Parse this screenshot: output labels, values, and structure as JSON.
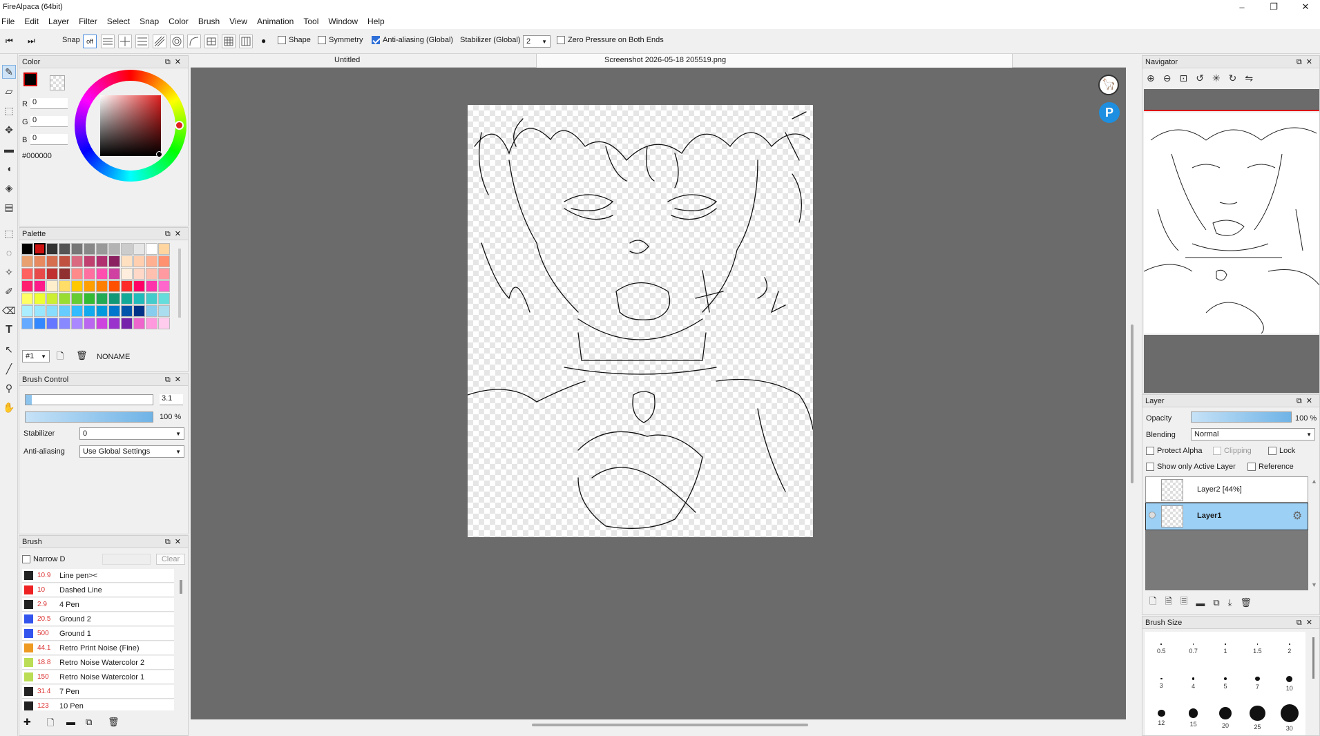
{
  "window": {
    "title": "FireAlpaca (64bit)",
    "minimize": "–",
    "maximize": "❐",
    "close": "✕"
  },
  "menu": [
    "File",
    "Edit",
    "Layer",
    "Filter",
    "Select",
    "Snap",
    "Color",
    "Brush",
    "View",
    "Animation",
    "Tool",
    "Window",
    "Help"
  ],
  "toolbar": {
    "snap_label": "Snap",
    "snap_off": "off",
    "shape_label": "Shape",
    "symmetry_label": "Symmetry",
    "antialias_label": "Anti-aliasing (Global)",
    "stabilizer_label": "Stabilizer (Global)",
    "stabilizer_value": "2",
    "zero_pressure_label": "Zero Pressure on Both Ends"
  },
  "tabs": {
    "untitled": "Untitled",
    "screenshot": "Screenshot 2026-05-18 205519.png"
  },
  "color_panel": {
    "title": "Color",
    "r_label": "R",
    "r_value": "0",
    "g_label": "G",
    "g_value": "0",
    "b_label": "B",
    "b_value": "0",
    "hex": "#000000"
  },
  "palette_panel": {
    "title": "Palette",
    "index": "#1",
    "name": "NONAME",
    "colors": [
      "#000000",
      "#cc1111",
      "#333333",
      "#555555",
      "#777777",
      "#888888",
      "#999999",
      "#b3b3b3",
      "#cccccc",
      "#e6e6e6",
      "#ffffff",
      "#ffd5a0",
      "#e8a070",
      "#e88a60",
      "#d66e50",
      "#c05040",
      "#d96a80",
      "#c04070",
      "#b03070",
      "#8a2060",
      "#ffe0c0",
      "#ffcfb0",
      "#ffb090",
      "#ff9070",
      "#ff6060",
      "#e84a4a",
      "#c03030",
      "#903030",
      "#ff8a8a",
      "#ff70a0",
      "#ff50b0",
      "#d040a0",
      "#ffeedd",
      "#ffd8c8",
      "#ffc0b0",
      "#ff9aa0",
      "#ff2070",
      "#ff1a8a",
      "#ffeecc",
      "#ffdd66",
      "#ffc800",
      "#ffa000",
      "#ff8000",
      "#ff5000",
      "#ff2a2a",
      "#ff0066",
      "#ff33aa",
      "#ff66cc",
      "#ffff66",
      "#eeff33",
      "#ccee33",
      "#99dd33",
      "#66cc33",
      "#33bb33",
      "#22aa55",
      "#119977",
      "#11aa99",
      "#22bbbb",
      "#44cccc",
      "#66dddd",
      "#aaeeff",
      "#99e6ff",
      "#88ddff",
      "#66ccff",
      "#33bbff",
      "#11aaee",
      "#0099dd",
      "#0077cc",
      "#0055aa",
      "#003388",
      "#88ccee",
      "#aaddee",
      "#66aaff",
      "#3388ff",
      "#6677ff",
      "#8888ff",
      "#aa88ff",
      "#bb66ee",
      "#cc44dd",
      "#9933cc",
      "#7722aa",
      "#ee66cc",
      "#ff99dd",
      "#ffccee"
    ]
  },
  "brush_control": {
    "title": "Brush Control",
    "size": "3.1",
    "size_fill": 0.05,
    "opacity": "100 %",
    "opacity_fill": 1.0,
    "stabilizer_label": "Stabilizer",
    "stabilizer_value": "0",
    "antialias_label": "Anti-aliasing",
    "antialias_value": "Use Global Settings"
  },
  "brush_panel": {
    "title": "Brush",
    "narrow_label": "Narrow D",
    "clear_label": "Clear",
    "items": [
      {
        "color": "#222222",
        "size": "10.9",
        "name": "Line pen><"
      },
      {
        "color": "#ee2222",
        "size": "10",
        "name": "Dashed Line"
      },
      {
        "color": "#222222",
        "size": "2.9",
        "name": "4 Pen"
      },
      {
        "color": "#3355ee",
        "size": "20.5",
        "name": "Ground 2"
      },
      {
        "color": "#3355ee",
        "size": "500",
        "name": "Ground 1"
      },
      {
        "color": "#ee9922",
        "size": "44.1",
        "name": "Retro Print Noise (Fine)"
      },
      {
        "color": "#bbdd55",
        "size": "18.8",
        "name": "Retro Noise Watercolor 2"
      },
      {
        "color": "#bbdd55",
        "size": "150",
        "name": "Retro Noise Watercolor 1"
      },
      {
        "color": "#222222",
        "size": "31.4",
        "name": "7 Pen"
      },
      {
        "color": "#222222",
        "size": "123",
        "name": "10 Pen"
      }
    ]
  },
  "navigator": {
    "title": "Navigator"
  },
  "layer_panel": {
    "title": "Layer",
    "opacity_label": "Opacity",
    "opacity_value": "100 %",
    "blending_label": "Blending",
    "blending_value": "Normal",
    "protect_alpha": "Protect Alpha",
    "clipping": "Clipping",
    "lock": "Lock",
    "show_active": "Show only Active Layer",
    "reference": "Reference",
    "layers": [
      {
        "name": "Layer2 [44%]",
        "active": false
      },
      {
        "name": "Layer1",
        "active": true
      }
    ]
  },
  "brush_size": {
    "title": "Brush Size",
    "sizes": [
      "0.5",
      "0.7",
      "1",
      "1.5",
      "2",
      "3",
      "4",
      "5",
      "7",
      "10",
      "12",
      "15",
      "20",
      "25",
      "30"
    ]
  }
}
